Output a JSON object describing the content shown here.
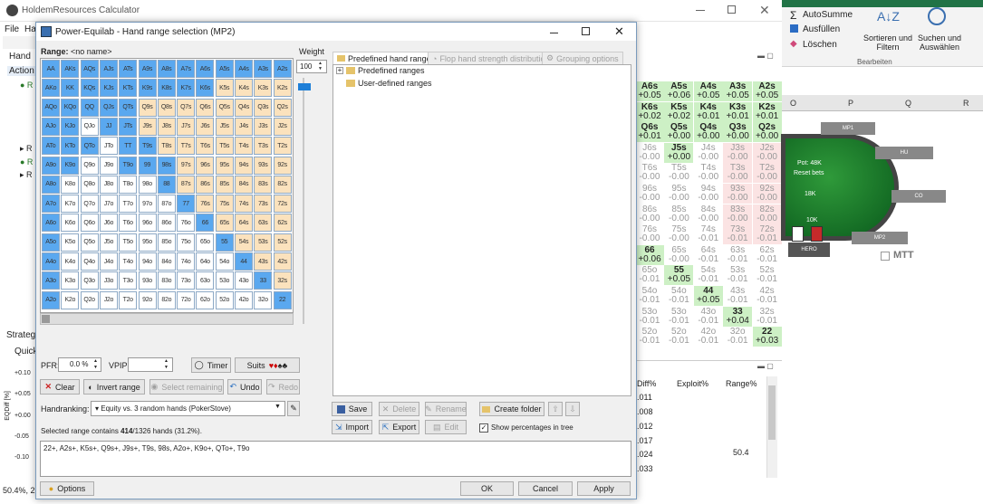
{
  "bg": {
    "title": "HoldemResources Calculator",
    "menu": [
      "File",
      "Ha"
    ],
    "side_tabs": [
      "Hand",
      "Action"
    ],
    "strategy_label": "Strategy",
    "quick_label": "Quick",
    "y_axis_label": "EQDiff [%]",
    "y_ticks": [
      "+0.10",
      "+0.05",
      "+0.00",
      "-0.05",
      "-0.10"
    ],
    "bottom_left": "50.4%, 22",
    "mtt": "MTT",
    "hero": "HERO",
    "pot": "Pot: 48K",
    "reset_bets": "Reset bets",
    "bet_18k": "18K",
    "bet_10k": "10K",
    "seat_labels": [
      "MP1",
      "HU",
      "CO",
      "MP2",
      "HERO",
      "MTT"
    ],
    "right_panel_header": [
      "Diff%",
      "Exploit%",
      "Range%"
    ],
    "right_panel_rows": [
      ".011",
      ".008",
      ".012",
      ".017",
      ".024",
      ".033"
    ],
    "range_value": "50.4",
    "excel_cols": [
      "O",
      "P",
      "Q",
      "R"
    ],
    "excel": {
      "autosum": "AutoSumme",
      "fill": "Ausfüllen",
      "clear": "Löschen",
      "sort": "Sortieren und Filtern",
      "find": "Suchen und Auswählen",
      "group": "Bearbeiten"
    }
  },
  "ev_grid": [
    [
      [
        "A6s",
        "+0.05"
      ],
      [
        "A5s",
        "+0.06"
      ],
      [
        "A4s",
        "+0.05"
      ],
      [
        "A3s",
        "+0.05"
      ],
      [
        "A2s",
        "+0.05"
      ]
    ],
    [
      [
        "K6s",
        "+0.02"
      ],
      [
        "K5s",
        "+0.02"
      ],
      [
        "K4s",
        "+0.01"
      ],
      [
        "K3s",
        "+0.01"
      ],
      [
        "K2s",
        "+0.01"
      ]
    ],
    [
      [
        "Q6s",
        "+0.01"
      ],
      [
        "Q5s",
        "+0.00"
      ],
      [
        "Q4s",
        "+0.00"
      ],
      [
        "Q3s",
        "+0.00"
      ],
      [
        "Q2s",
        "+0.00"
      ]
    ],
    [
      [
        "J6s",
        "-0.00"
      ],
      [
        "J5s",
        "+0.00"
      ],
      [
        "J4s",
        "-0.00"
      ],
      [
        "J3s",
        "-0.00"
      ],
      [
        "J2s",
        "-0.00"
      ]
    ],
    [
      [
        "T6s",
        "-0.00"
      ],
      [
        "T5s",
        "-0.00"
      ],
      [
        "T4s",
        "-0.00"
      ],
      [
        "T3s",
        "-0.00"
      ],
      [
        "T2s",
        "-0.00"
      ]
    ],
    [
      [
        "96s",
        "-0.00"
      ],
      [
        "95s",
        "-0.00"
      ],
      [
        "94s",
        "-0.00"
      ],
      [
        "93s",
        "-0.00"
      ],
      [
        "92s",
        "-0.00"
      ]
    ],
    [
      [
        "86s",
        "-0.00"
      ],
      [
        "85s",
        "-0.00"
      ],
      [
        "84s",
        "-0.00"
      ],
      [
        "83s",
        "-0.00"
      ],
      [
        "82s",
        "-0.00"
      ]
    ],
    [
      [
        "76s",
        "-0.00"
      ],
      [
        "75s",
        "-0.00"
      ],
      [
        "74s",
        "-0.01"
      ],
      [
        "73s",
        "-0.01"
      ],
      [
        "72s",
        "-0.01"
      ]
    ],
    [
      [
        "66",
        "+0.06"
      ],
      [
        "65s",
        "-0.00"
      ],
      [
        "64s",
        "-0.01"
      ],
      [
        "63s",
        "-0.01"
      ],
      [
        "62s",
        "-0.01"
      ]
    ],
    [
      [
        "65o",
        "-0.01"
      ],
      [
        "55",
        "+0.05"
      ],
      [
        "54s",
        "-0.01"
      ],
      [
        "53s",
        "-0.01"
      ],
      [
        "52s",
        "-0.01"
      ]
    ],
    [
      [
        "54o",
        "-0.01"
      ],
      [
        "54o",
        "-0.01"
      ],
      [
        "44",
        "+0.05"
      ],
      [
        "43s",
        "-0.01"
      ],
      [
        "42s",
        "-0.01"
      ]
    ],
    [
      [
        "53o",
        "-0.01"
      ],
      [
        "53o",
        "-0.01"
      ],
      [
        "43o",
        "-0.01"
      ],
      [
        "33",
        "+0.04"
      ],
      [
        "32s",
        "-0.01"
      ]
    ],
    [
      [
        "52o",
        "-0.01"
      ],
      [
        "52o",
        "-0.01"
      ],
      [
        "42o",
        "-0.01"
      ],
      [
        "32o",
        "-0.01"
      ],
      [
        "22",
        "+0.03"
      ]
    ]
  ],
  "dialog": {
    "title": "Power-Equilab - Hand range selection (MP2)",
    "range_label": "Range:",
    "range_name": "<no name>",
    "weight_label": "Weight",
    "weight_value": "100",
    "tabs": [
      "Predefined hand ranges",
      "Flop hand strength distribution",
      "Grouping options"
    ],
    "tree": [
      "Predefined ranges",
      "User-defined ranges"
    ],
    "pfr_label": "PFR:",
    "pfr_value": "0.0 %",
    "vpip_label": "VPIP:",
    "vpip_value": "",
    "timer": "Timer",
    "suits": "Suits",
    "clear": "Clear",
    "invert": "Invert range",
    "select_remaining": "Select remaining",
    "undo": "Undo",
    "redo": "Redo",
    "handranking_label": "Handranking:",
    "handranking_value": "Equity vs. 3 random hands (PokerStove)",
    "summary_pre": "Selected range contains ",
    "summary_bold": "414",
    "summary_post": "/1326 hands (31.2%).",
    "range_text": "22+, A2s+, K5s+, Q9s+, J9s+, T9s, 98s, A2o+, K9o+, QTo+, T9o",
    "save": "Save",
    "delete": "Delete",
    "rename": "Rename",
    "create_folder": "Create folder",
    "import": "Import",
    "export": "Export",
    "edit": "Edit",
    "show_pct": "Show percentages in tree",
    "options": "Options",
    "ok": "OK",
    "cancel": "Cancel",
    "apply": "Apply"
  },
  "grid_selected_rows": [
    [
      1,
      1,
      1,
      1,
      1,
      1,
      1,
      1,
      1,
      1,
      1,
      1,
      1
    ],
    [
      1,
      1,
      1,
      1,
      1,
      1,
      1,
      1,
      1,
      0,
      0,
      0,
      0
    ],
    [
      1,
      1,
      1,
      1,
      1,
      0,
      0,
      0,
      0,
      0,
      0,
      0,
      0
    ],
    [
      1,
      1,
      0,
      1,
      1,
      0,
      0,
      0,
      0,
      0,
      0,
      0,
      0
    ],
    [
      1,
      1,
      1,
      0,
      1,
      1,
      0,
      0,
      0,
      0,
      0,
      0,
      0
    ],
    [
      1,
      1,
      0,
      0,
      1,
      1,
      1,
      0,
      0,
      0,
      0,
      0,
      0
    ],
    [
      1,
      0,
      0,
      0,
      0,
      0,
      1,
      0,
      0,
      0,
      0,
      0,
      0
    ],
    [
      1,
      0,
      0,
      0,
      0,
      0,
      0,
      1,
      0,
      0,
      0,
      0,
      0
    ],
    [
      1,
      0,
      0,
      0,
      0,
      0,
      0,
      0,
      1,
      0,
      0,
      0,
      0
    ],
    [
      1,
      0,
      0,
      0,
      0,
      0,
      0,
      0,
      0,
      1,
      0,
      0,
      0
    ],
    [
      1,
      0,
      0,
      0,
      0,
      0,
      0,
      0,
      0,
      0,
      1,
      0,
      0
    ],
    [
      1,
      0,
      0,
      0,
      0,
      0,
      0,
      0,
      0,
      0,
      0,
      1,
      0
    ],
    [
      1,
      0,
      0,
      0,
      0,
      0,
      0,
      0,
      0,
      0,
      0,
      0,
      1
    ]
  ],
  "colors": {
    "selected": "#5aa8ef",
    "suited": "#fbe2bd",
    "offsuit": "#ffffff"
  }
}
